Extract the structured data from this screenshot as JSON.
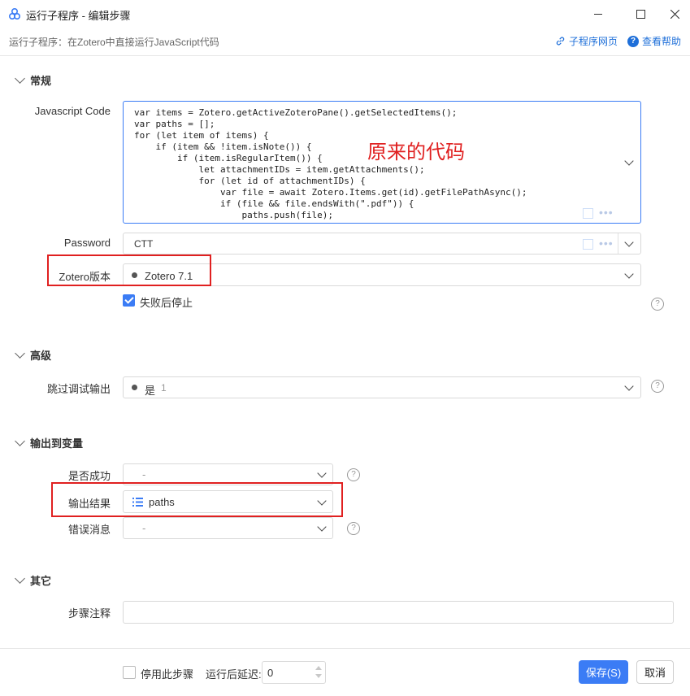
{
  "window": {
    "title": "运行子程序 - 编辑步骤",
    "subtitle": "运行子程序：在Zotero中直接运行JavaScript代码",
    "links": {
      "subprogram_page": "子程序网页",
      "help": "查看帮助"
    }
  },
  "sections": {
    "general": "常规",
    "advanced": "高级",
    "output": "输出到变量",
    "other": "其它"
  },
  "general": {
    "js_label": "Javascript Code",
    "code_lines": [
      "var items = Zotero.getActiveZoteroPane().getSelectedItems();",
      "var paths = [];",
      "for (let item of items) {",
      "    if (item && !item.isNote()) {",
      "        if (item.isRegularItem()) {",
      "            let attachmentIDs = item.getAttachments();",
      "            for (let id of attachmentIDs) {",
      "                var file = await Zotero.Items.get(id).getFilePathAsync();",
      "                if (file && file.endsWith(\".pdf\")) {",
      "                    paths.push(file);"
    ],
    "annotation": "原来的代码",
    "password_label": "Password",
    "password_value": "CTT",
    "zotero_label": "Zotero版本",
    "zotero_value": "Zotero 7.1",
    "stop_on_fail": "失败后停止"
  },
  "advanced": {
    "skip_debug_label": "跳过调试输出",
    "skip_debug_value": "是",
    "skip_debug_extra": "1"
  },
  "output": {
    "success_label": "是否成功",
    "success_value": "-",
    "result_label": "输出结果",
    "result_value": "paths",
    "error_label": "错误消息",
    "error_value": "-"
  },
  "other": {
    "note_label": "步骤注释",
    "note_value": ""
  },
  "footer": {
    "disable_step": "停用此步骤",
    "delay_label": "运行后延迟:",
    "delay_value": "0",
    "save": "保存(S)",
    "cancel": "取消"
  },
  "colors": {
    "accent": "#3b7cf5",
    "highlight": "#e02020"
  }
}
